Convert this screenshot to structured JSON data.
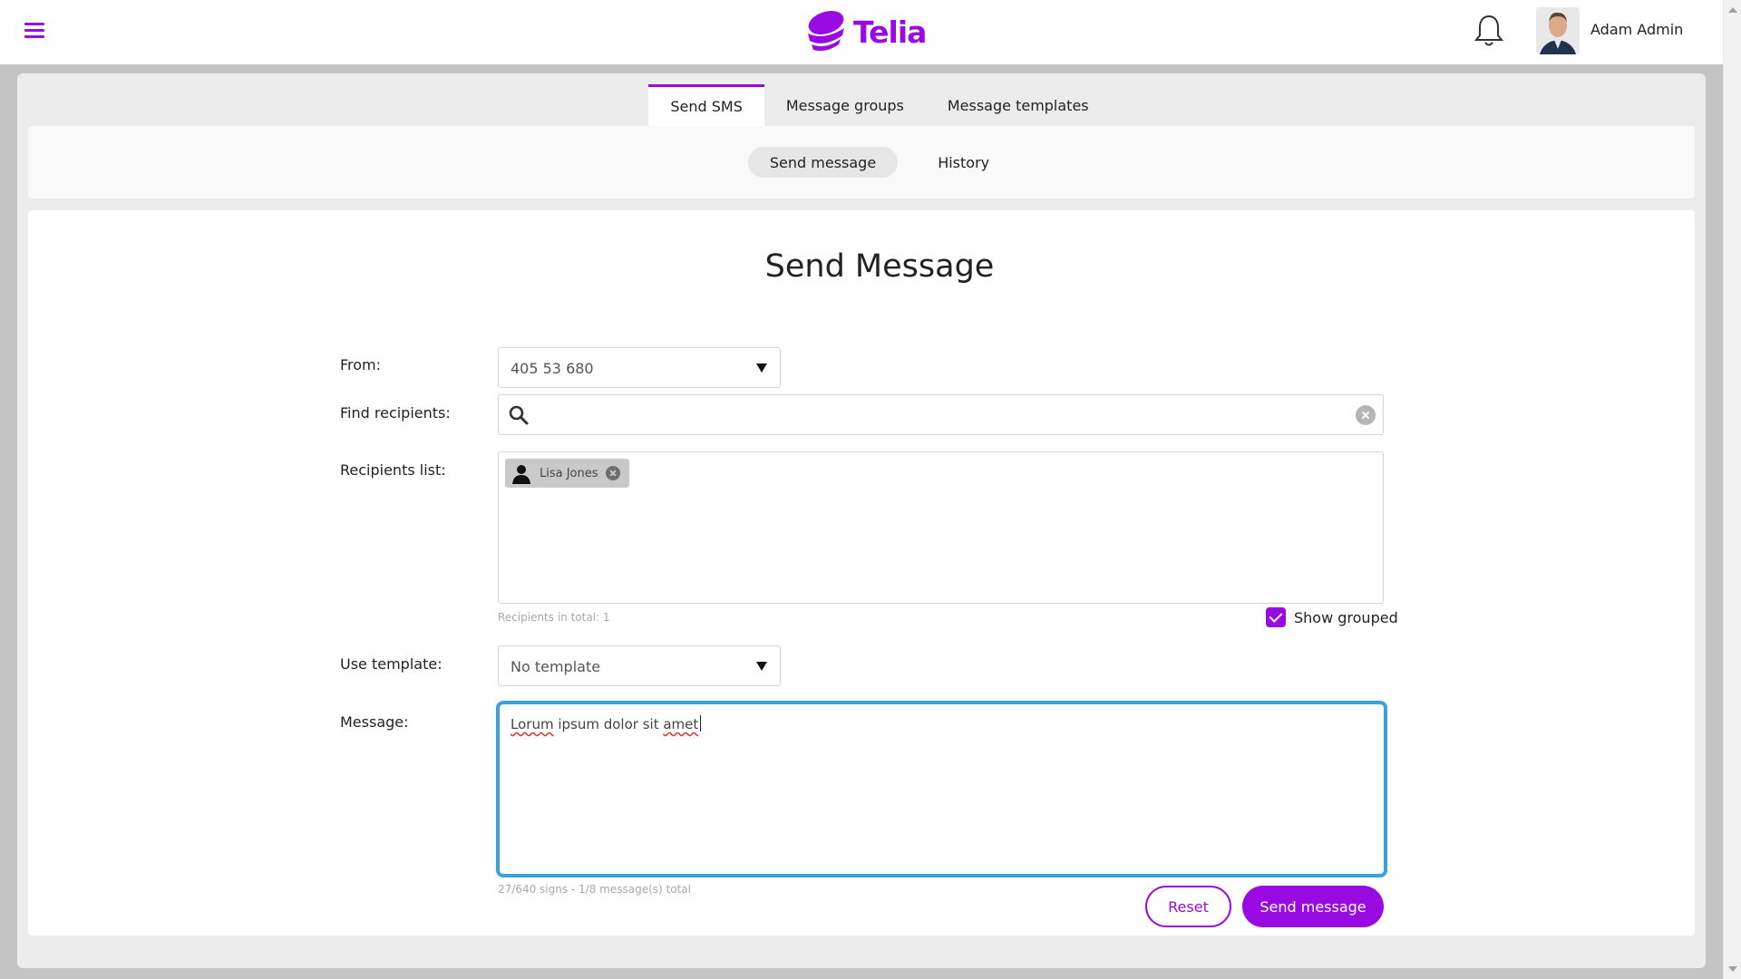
{
  "header": {
    "brand": "Telia",
    "user_name": "Adam Admin"
  },
  "tabs": [
    {
      "label": "Send SMS",
      "active": true
    },
    {
      "label": "Message groups",
      "active": false
    },
    {
      "label": "Message templates",
      "active": false
    }
  ],
  "subtabs": [
    {
      "label": "Send message",
      "active": true
    },
    {
      "label": "History",
      "active": false
    }
  ],
  "form": {
    "title": "Send Message",
    "from_label": "From:",
    "from_value": "405 53 680",
    "find_label": "Find recipients:",
    "find_value": "",
    "recipients_label": "Recipients list:",
    "recipients": [
      {
        "name": "Lisa Jones"
      }
    ],
    "recipients_total": "Recipients in total: 1",
    "show_grouped_label": "Show grouped",
    "show_grouped_checked": true,
    "template_label": "Use template:",
    "template_value": "No template",
    "message_label": "Message:",
    "message_words": [
      "Lorum",
      "ipsum dolor sit",
      "amet"
    ],
    "message_counter": "27/640 signs - 1/8 message(s) total",
    "reset_label": "Reset",
    "send_label": "Send message"
  },
  "colors": {
    "brand": "#990ae3",
    "focus": "#3aa0e0"
  }
}
